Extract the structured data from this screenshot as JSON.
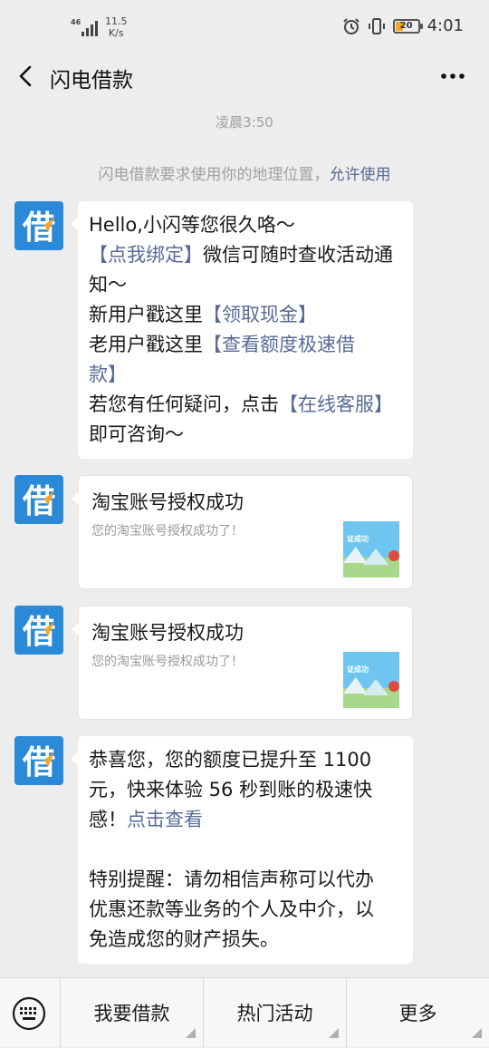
{
  "status_bar": {
    "network": "46",
    "speed": "11.5",
    "speed_unit": "K/s",
    "battery": "20",
    "time": "4:01"
  },
  "nav": {
    "title": "闪电借款",
    "back_icon": "chevron-left-icon",
    "more_icon": "more-dots-icon"
  },
  "chat": {
    "timestamp": "凌晨3:50",
    "location_notice": {
      "text": "闪电借款要求使用你的地理位置，",
      "link": "允许使用"
    },
    "avatar_char": "借",
    "message1": {
      "line1": "Hello,小闪等您很久咯～",
      "bind_link": "【点我绑定】",
      "bind_rest_a": "微信可随时查收活动通",
      "bind_rest_b": "知～",
      "new_user_prefix": "新用户戳这里",
      "new_user_link": "【领取现金】",
      "old_user_prefix": "老用户戳这里",
      "old_user_link_a": "【查看额度极速借",
      "old_user_link_b": "款】",
      "question_prefix": "若您有任何疑问，点击",
      "question_link": "【在线客服】",
      "question_suffix": "即可咨询～"
    },
    "card1": {
      "title": "淘宝账号授权成功",
      "desc": "您的淘宝账号授权成功了！",
      "thumb_text": "证成功"
    },
    "card2": {
      "title": "淘宝账号授权成功",
      "desc": "您的淘宝账号授权成功了！",
      "thumb_text": "证成功"
    },
    "message2": {
      "line1": "恭喜您，您的额度已提升至 1100",
      "line2": "元，快来体验 56 秒到账的极速快",
      "line3_prefix": "感！",
      "line3_link": "点击查看",
      "warn1": "特别提醒：请勿相信声称可以代办",
      "warn2": "优惠还款等业务的个人及中介，以",
      "warn3": "免造成您的财产损失。"
    }
  },
  "bottom_menu": {
    "keyboard_icon": "keyboard-icon",
    "items": [
      {
        "label": "我要借款"
      },
      {
        "label": "热门活动"
      },
      {
        "label": "更多"
      }
    ]
  },
  "colors": {
    "background": "#ededed",
    "link": "#576b95",
    "avatar": "#2a8ad8",
    "bubble": "#ffffff"
  }
}
